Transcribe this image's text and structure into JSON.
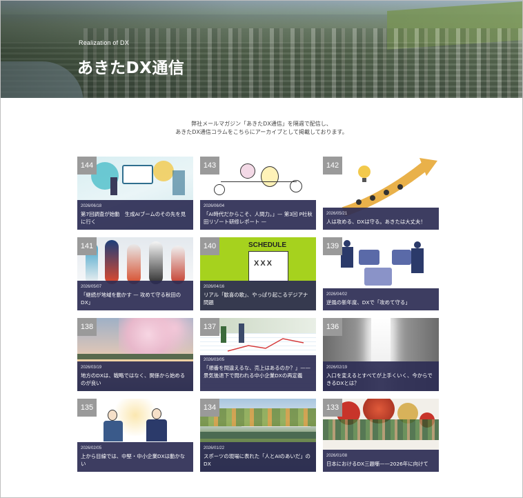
{
  "hero": {
    "subtitle": "Realization of DX",
    "title": "あきたDX通信"
  },
  "intro": {
    "line1": "弊社メールマガジン「あきたDX通信」を隔週で配信し、",
    "line2": "あきたDX通信コラムをこちらにアーカイブとして掲載しております。"
  },
  "articles": [
    {
      "number": "144",
      "date": "2026/06/18",
      "title": "第7回調査が始動　生成AIブームのその先を見に行く"
    },
    {
      "number": "143",
      "date": "2026/06/04",
      "title": "「AI時代だからこそ、人間力。」— 第3回 P社秋田リゾート研修レポート —"
    },
    {
      "number": "142",
      "date": "2026/05/21",
      "title": "人は攻める、DXは守る。あきたは大丈夫！"
    },
    {
      "number": "141",
      "date": "2026/05/07",
      "title": "「継続が地域を動かす — 攻めて守る秋田のDX」"
    },
    {
      "number": "140",
      "date": "2026/04/16",
      "title": "リアル「歓喜の歌」、やっぱり起こるデジアナ問題"
    },
    {
      "number": "139",
      "date": "2026/04/02",
      "title": "逆風の新年度、DXで「攻めて守る」"
    },
    {
      "number": "138",
      "date": "2026/03/19",
      "title": "地方のDXは、戦略ではなく、関係から始めるのが良い"
    },
    {
      "number": "137",
      "date": "2026/03/05",
      "title": "「順番を間違えるな、売上はあるのか？」——景気後退下で問われる中小企業DXの再定義"
    },
    {
      "number": "136",
      "date": "2026/02/19",
      "title": "入口を変えるとすべてが上手くいく、今からできるDXとは？"
    },
    {
      "number": "135",
      "date": "2026/02/05",
      "title": "上から目線では、中堅・中小企業DXは動かない"
    },
    {
      "number": "134",
      "date": "2026/01/22",
      "title": "スポーツの現場に表れた「人とAIのあいだ」のDX"
    },
    {
      "number": "133",
      "date": "2026/01/08",
      "title": "日本におけるDX三題噺——2026年に向けて"
    }
  ],
  "illustrations": {
    "schedule_sign": "SCHEDULE",
    "calendar_marks": "XXX"
  },
  "colors": {
    "overlay": "#2c2c54",
    "number_badge": "#9a9a9a",
    "schedule_bg": "#a6d21e",
    "arrow": "#e9b14a"
  }
}
